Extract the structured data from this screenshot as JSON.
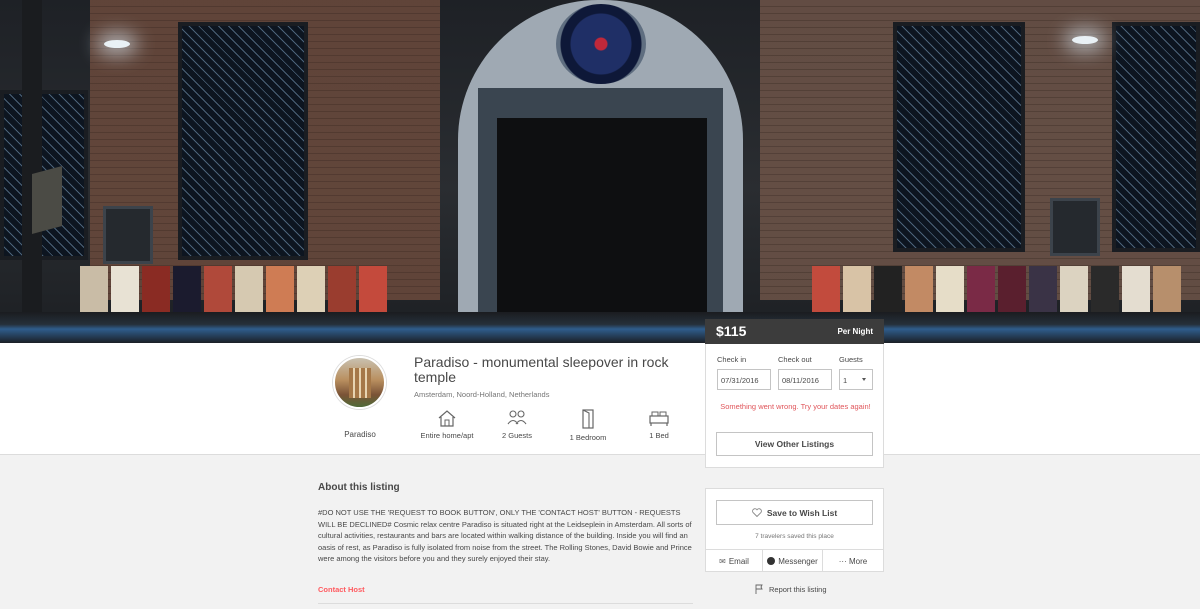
{
  "listing": {
    "price": "$115",
    "price_period": "Per Night",
    "title": "Paradiso - monumental sleepover in rock temple",
    "location": "Amsterdam, Noord-Holland, Netherlands",
    "host_name": "Paradiso"
  },
  "amenities": [
    {
      "label": "Entire home/apt",
      "icon": "home-icon"
    },
    {
      "label": "2 Guests",
      "icon": "guests-icon"
    },
    {
      "label": "1 Bedroom",
      "icon": "door-icon"
    },
    {
      "label": "1 Bed",
      "icon": "bed-icon"
    }
  ],
  "booking": {
    "checkin_label": "Check in",
    "checkout_label": "Check out",
    "guests_label": "Guests",
    "checkin_value": "07/31/2016",
    "checkout_value": "08/11/2016",
    "guests_value": "1",
    "error": "Something went wrong. Try your dates again!",
    "view_other": "View Other Listings"
  },
  "about": {
    "heading": "About this listing",
    "description": "#DO NOT USE THE 'REQUEST TO BOOK BUTTON', ONLY THE 'CONTACT HOST' BUTTON - REQUESTS WILL BE DECLINED# Cosmic relax centre Paradiso is situated right at the Leidseplein in Amsterdam. All sorts of cultural activities, restaurants and bars are located within walking distance of the building. Inside you will find an oasis of rest, as Paradiso is fully isolated from noise from the street. The Rolling Stones, David Bowie and Prince were among the visitors before you and they surely enjoyed their stay.",
    "contact_host": "Contact Host"
  },
  "wishlist": {
    "save_label": "Save to Wish List",
    "saved_count": "7 travelers saved this place",
    "email": "Email",
    "messenger": "Messenger",
    "more": "··· More",
    "report": "Report this listing"
  },
  "colors": {
    "accent": "#ff5a5f",
    "error": "#e0565b",
    "price_bar": "#3c3c3c"
  }
}
